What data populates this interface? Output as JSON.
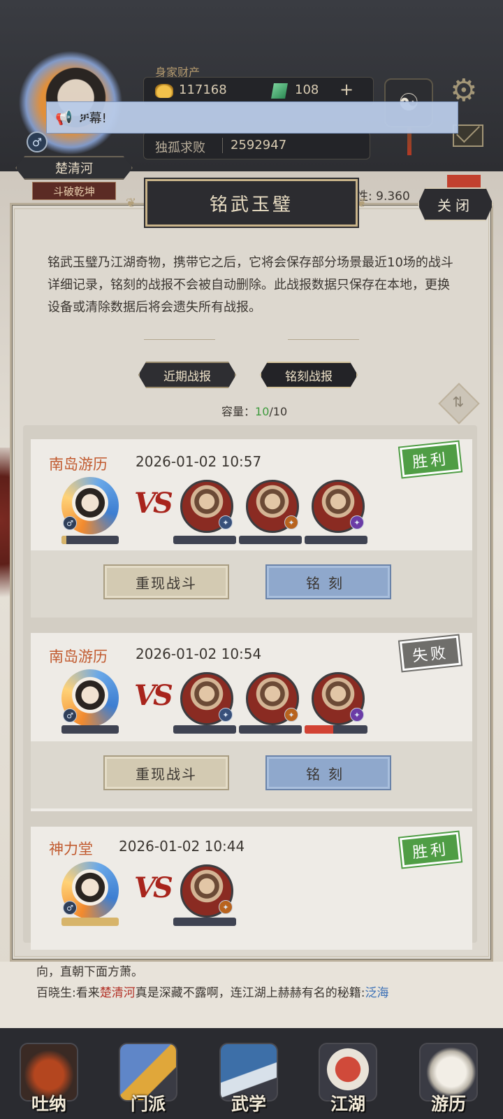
{
  "header": {
    "wealth_label": "身家财产",
    "gold": "117168",
    "jade": "108",
    "plus": "+",
    "rank_label": "独孤求败",
    "rank_value": "2592947",
    "player_name": "楚清河",
    "player_sect": "斗破乾坤",
    "gender_symbol": "♂",
    "notice_text": "幕!",
    "notice_prefix": "ቻ",
    "stat_text": "性: 9.360"
  },
  "panel": {
    "title": "铭武玉璧",
    "close_label": "关闭",
    "description": "铭武玉璧乃江湖奇物，携带它之后，它将会保存部分场景最近10场的战斗详细记录，铭刻的战报不会被自动删除。此战报数据只保存在本地，更换设备或清除数据后将会遗失所有战报。",
    "tabs": [
      {
        "label": "近期战报"
      },
      {
        "label": "铭刻战报"
      }
    ],
    "capacity_label": "容量：",
    "capacity_used": "10",
    "capacity_total": "/10"
  },
  "reports": [
    {
      "place": "南岛游历",
      "time": "2026-01-02 10:57",
      "result": "胜利",
      "hero_hp": 0.08,
      "enemies_hp": [
        0,
        0,
        0
      ],
      "replay_label": "重现战斗",
      "engrave_label": "铭刻"
    },
    {
      "place": "南岛游历",
      "time": "2026-01-02 10:54",
      "result": "失败",
      "hero_hp": 0,
      "enemies_hp": [
        0,
        0,
        0.45
      ],
      "replay_label": "重现战斗",
      "engrave_label": "铭刻"
    },
    {
      "place": "神力堂",
      "time": "2026-01-02 10:44",
      "result": "胜利",
      "hero_hp": 1.0,
      "enemies_hp": [
        0
      ]
    }
  ],
  "vs_text": "VS",
  "log": {
    "line1": "向，直朝下面方萧。",
    "line2_prefix": "百晓生:看来",
    "line2_name": "楚清河",
    "line2_mid": "真是深藏不露啊，连江湖上赫赫有名的秘籍:",
    "line2_book": "泛海"
  },
  "bottom_nav": [
    {
      "label": "吐纳",
      "icon": "gourd-icon"
    },
    {
      "label": "门派",
      "icon": "sect-icon"
    },
    {
      "label": "武学",
      "icon": "scroll-icon"
    },
    {
      "label": "江湖",
      "icon": "hat-icon"
    },
    {
      "label": "游历",
      "icon": "horse-icon"
    }
  ],
  "colors": {
    "accent_orange": "#c15a2f",
    "win_green": "#4f9d45",
    "lose_gray": "#6f6e6b",
    "capacity_green": "#3d9a3d"
  }
}
